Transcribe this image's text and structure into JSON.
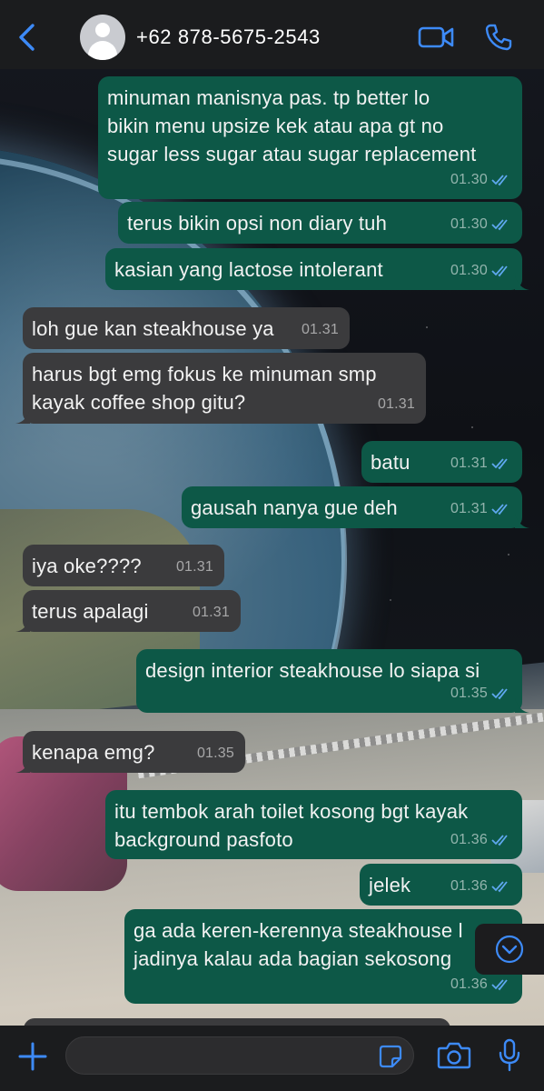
{
  "header": {
    "contact_name": "+62 878-5675-2543",
    "back_icon": "chevron-left-icon",
    "video_icon": "video-camera-icon",
    "call_icon": "phone-icon"
  },
  "messages": [
    {
      "dir": "out",
      "text": "minuman manisnya pas. tp better lo\nbikin menu upsize kek atau apa gt no\nsugar less sugar atau sugar replacement",
      "time": "01.30",
      "status": "read"
    },
    {
      "dir": "out",
      "text": "terus bikin opsi non diary tuh",
      "time": "01.30",
      "status": "read"
    },
    {
      "dir": "out",
      "text": "kasian yang lactose intolerant",
      "time": "01.30",
      "status": "read"
    },
    {
      "dir": "in",
      "text": "loh gue kan steakhouse ya",
      "time": "01.31"
    },
    {
      "dir": "in",
      "text": "harus bgt emg fokus ke minuman smp\nkayak coffee shop gitu?",
      "time": "01.31"
    },
    {
      "dir": "out",
      "text": "batu",
      "time": "01.31",
      "status": "read"
    },
    {
      "dir": "out",
      "text": "gausah nanya gue deh",
      "time": "01.31",
      "status": "read"
    },
    {
      "dir": "in",
      "text": "iya oke????",
      "time": "01.31"
    },
    {
      "dir": "in",
      "text": "terus apalagi",
      "time": "01.31"
    },
    {
      "dir": "out",
      "text": "design interior steakhouse lo siapa si",
      "time": "01.35",
      "status": "read"
    },
    {
      "dir": "in",
      "text": "kenapa emg?",
      "time": "01.35"
    },
    {
      "dir": "out",
      "text": "itu tembok arah toilet kosong bgt kayak\nbackground pasfoto",
      "time": "01.36",
      "status": "read"
    },
    {
      "dir": "out",
      "text": "jelek",
      "time": "01.36",
      "status": "read"
    },
    {
      "dir": "out",
      "text": "ga ada keren-kerennya steakhouse l\njadinya kalau ada bagian sekosong",
      "time": "01.36",
      "status": "read"
    }
  ],
  "scroll_down_icon": "chevron-down-circle-icon",
  "composer": {
    "input_value": "",
    "plus_icon": "plus-icon",
    "sticker_icon": "sticker-icon",
    "camera_icon": "camera-icon",
    "mic_icon": "microphone-icon"
  },
  "colors": {
    "outgoing_bubble": "#0d5847",
    "incoming_bubble": "#3b3b3d",
    "accent": "#3d8af7",
    "read_ticks": "#5fa8f0"
  }
}
